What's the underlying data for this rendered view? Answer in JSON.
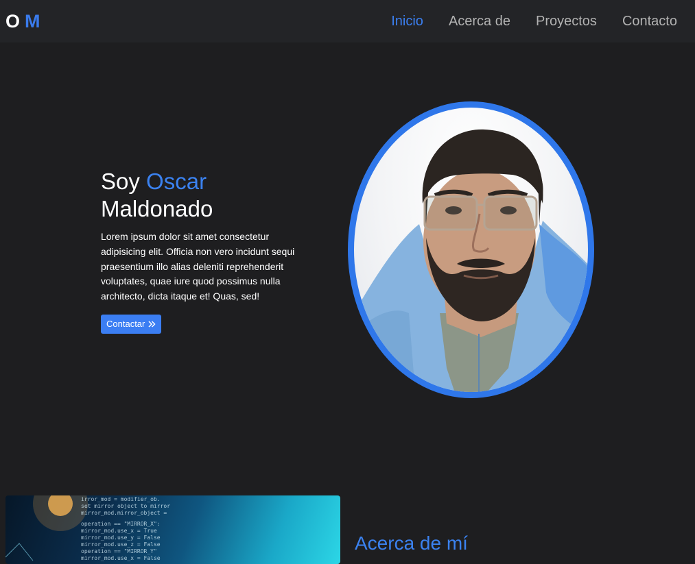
{
  "brand": {
    "first": "O",
    "second": "M"
  },
  "nav": {
    "items": [
      {
        "label": "Inicio",
        "active": true
      },
      {
        "label": "Acerca de",
        "active": false
      },
      {
        "label": "Proyectos",
        "active": false
      },
      {
        "label": "Contacto",
        "active": false
      }
    ]
  },
  "hero": {
    "title_prefix": "Soy ",
    "title_accent": "Oscar",
    "title_suffix": "Maldonado",
    "description": "Lorem ipsum dolor sit amet consectetur adipisicing elit. Officia non vero incidunt sequi praesentium illo alias deleniti reprehenderit voluptates, quae iure quod possimus nulla architecto, dicta itaque et! Quas, sed!",
    "button_label": "Contactar",
    "button_icon": "chevron-double-right-icon"
  },
  "about": {
    "title": "Acerca de mí"
  },
  "colors": {
    "accent": "#3b7ff0",
    "background": "#1e1e20",
    "navbar": "#232427",
    "nav_inactive": "#b2b2b2"
  }
}
